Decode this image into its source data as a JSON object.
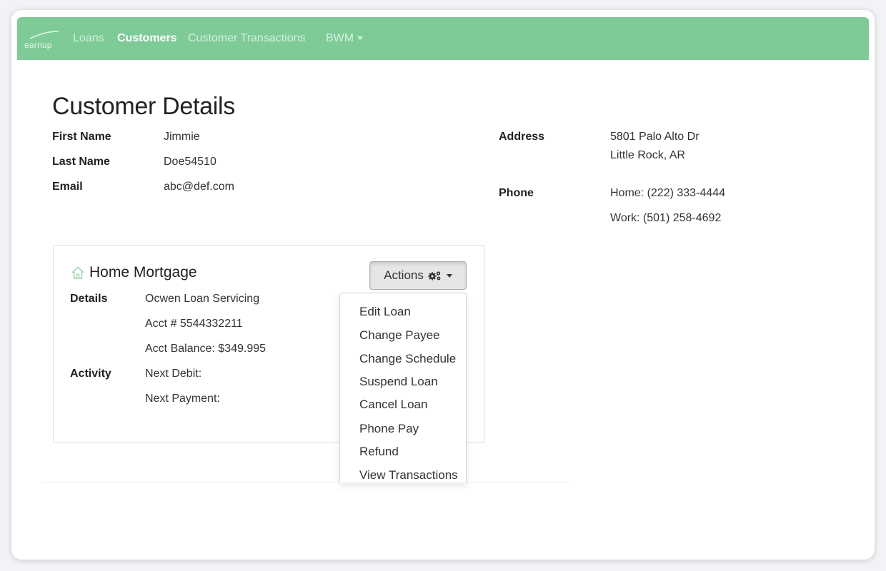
{
  "navbar": {
    "brand": "earnup",
    "items": [
      {
        "label": "Loans",
        "active": false
      },
      {
        "label": "Customers",
        "active": true
      },
      {
        "label": "Customer Transactions",
        "active": false
      },
      {
        "label": "BWM",
        "active": false,
        "dropdown": true
      }
    ]
  },
  "page": {
    "title": "Customer Details"
  },
  "customer": {
    "first_name_label": "First Name",
    "first_name": "Jimmie",
    "last_name_label": "Last Name",
    "last_name": "Doe54510",
    "email_label": "Email",
    "email": "abc@def.com",
    "address_label": "Address",
    "address_line1": "5801 Palo Alto Dr",
    "address_line2": "Little Rock, AR",
    "phone_label": "Phone",
    "phone_home": "Home: (222) 333-4444",
    "phone_work": "Work: (501) 258-4692"
  },
  "loan_card": {
    "title": "Home Mortgage",
    "icon": "home-icon",
    "actions_label": "Actions",
    "details_label": "Details",
    "servicer": "Ocwen Loan Servicing",
    "account": "Acct # 5544332211",
    "balance": "Acct Balance: $349.995",
    "activity_label": "Activity",
    "next_debit": "Next Debit:",
    "next_payment": "Next Payment:"
  },
  "actions_menu": {
    "items": [
      "Edit Loan",
      "Change Payee",
      "Change Schedule",
      "Suspend Loan",
      "Cancel Loan",
      "Phone Pay",
      "Refund",
      "View Transactions"
    ]
  },
  "colors": {
    "navbar": "#7ecb98",
    "nav_inactive": "#d6efdf",
    "nav_active": "#ffffff",
    "home_icon": "#9fd6b2"
  }
}
